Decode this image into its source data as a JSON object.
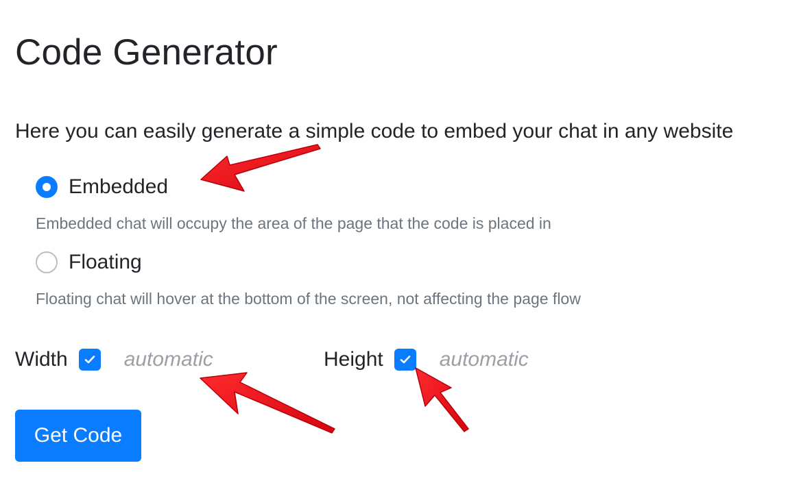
{
  "page": {
    "title": "Code Generator",
    "intro": "Here you can easily generate a simple code to embed your chat in any website"
  },
  "mode_options": [
    {
      "label": "Embedded",
      "checked": true,
      "description": "Embedded chat will occupy the area of the page that the code is placed in"
    },
    {
      "label": "Floating",
      "checked": false,
      "description": "Floating chat will hover at the bottom of the screen, not affecting the page flow"
    }
  ],
  "dimensions": {
    "width": {
      "label": "Width",
      "auto_checked": true,
      "value": "automatic"
    },
    "height": {
      "label": "Height",
      "auto_checked": true,
      "value": "automatic"
    }
  },
  "actions": {
    "get_code_label": "Get Code"
  },
  "icons": {
    "radio_selected": "radio-checked-icon",
    "radio_unselected": "radio-unchecked-icon",
    "checkbox": "checkmark-icon",
    "annotation": "red-arrow-icon"
  },
  "colors": {
    "primary": "#0a7cff",
    "text": "#212529",
    "muted": "#6c757d",
    "placeholder": "#9aa0a6",
    "annotation_red": "#e8141c"
  }
}
